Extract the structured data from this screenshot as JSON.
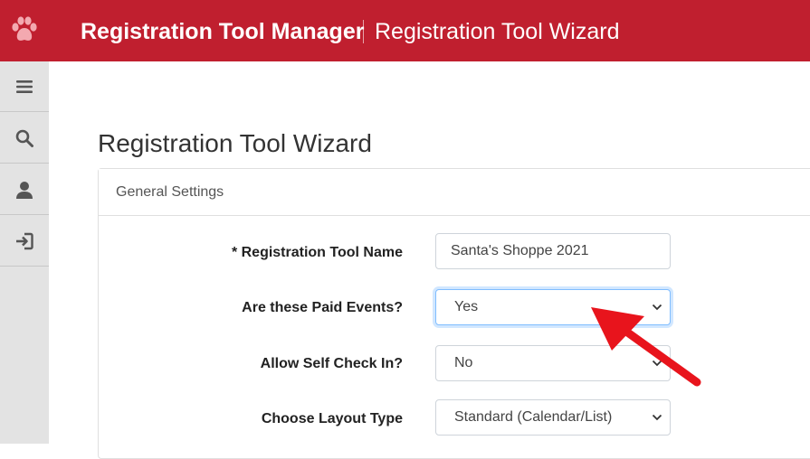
{
  "header": {
    "app_title": "Registration Tool Manager",
    "page_subtitle": "Registration Tool Wizard",
    "logo_icon": "paw-icon",
    "background_color": "#c01f2f"
  },
  "sidebar": {
    "items": [
      {
        "icon": "menu-icon"
      },
      {
        "icon": "search-icon"
      },
      {
        "icon": "user-icon"
      },
      {
        "icon": "logout-icon"
      }
    ]
  },
  "main": {
    "page_heading": "Registration Tool Wizard",
    "card": {
      "header_label": "General Settings",
      "fields": [
        {
          "label": "* Registration Tool Name",
          "value": "Santa's Shoppe 2021",
          "type": "text"
        },
        {
          "label": "Are these Paid Events?",
          "value": "Yes",
          "type": "select"
        },
        {
          "label": "Allow Self Check In?",
          "value": "No",
          "type": "select"
        },
        {
          "label": "Choose Layout Type",
          "value": "Standard (Calendar/List)",
          "type": "select"
        }
      ]
    }
  },
  "annotation": {
    "arrow_color": "#e8141c"
  }
}
